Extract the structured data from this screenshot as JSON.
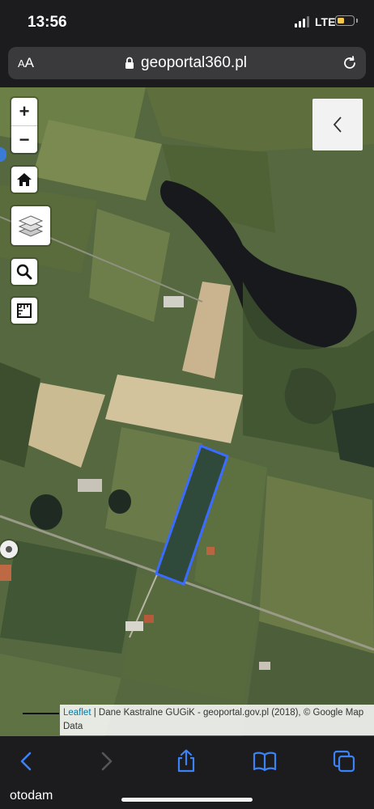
{
  "status_bar": {
    "time": "13:56",
    "network": "LTE",
    "battery_color": "#f2c94c"
  },
  "url_bar": {
    "aa_small": "A",
    "aa_large": "A",
    "domain": "geoportal360.pl"
  },
  "map": {
    "zoom_in": "+",
    "zoom_out": "−",
    "attribution_link": "Leaflet",
    "attribution_text": " | Dane Kastralne GUGiK - geoportal.gov.pl (2018), © Google Map Data",
    "parcel_color": "#3b6cff"
  },
  "toolbar": {
    "watermark": "otodam"
  }
}
